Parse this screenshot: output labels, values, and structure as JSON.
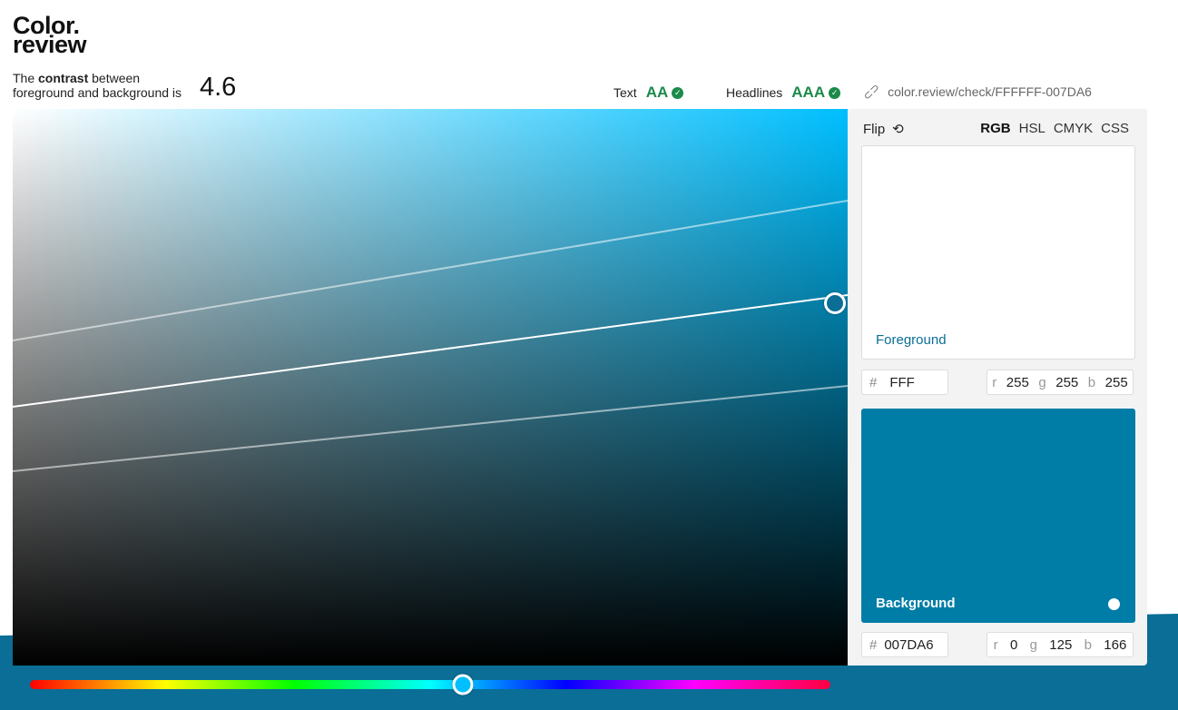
{
  "logo": {
    "line1": "Color.",
    "line2": "review"
  },
  "contrast": {
    "prefix": "The",
    "bold": "contrast",
    "suffix": "between",
    "line2": "foreground and background is",
    "value": "4.6"
  },
  "ratings": {
    "text_label": "Text",
    "text_grade": "AA",
    "headlines_label": "Headlines",
    "headlines_grade": "AAA"
  },
  "permalink": {
    "url": "color.review/check/FFFFFF-007DA6",
    "icon": "link-icon"
  },
  "panel": {
    "flip_label": "Flip",
    "flip_icon": "refresh-icon",
    "modes": [
      "RGB",
      "HSL",
      "CMYK",
      "CSS"
    ],
    "active_mode": "RGB",
    "foreground": {
      "label": "Foreground",
      "hex": "FFF",
      "r": "255",
      "g": "255",
      "b": "255",
      "color": "#ffffff"
    },
    "background": {
      "label": "Background",
      "hex": "007DA6",
      "r": "0",
      "g": "125",
      "b": "166",
      "color": "#007da6"
    }
  },
  "hue": {
    "color": "#00bfff"
  },
  "colors": {
    "accent": "#0a6e96",
    "pass": "#1b8a4a"
  }
}
